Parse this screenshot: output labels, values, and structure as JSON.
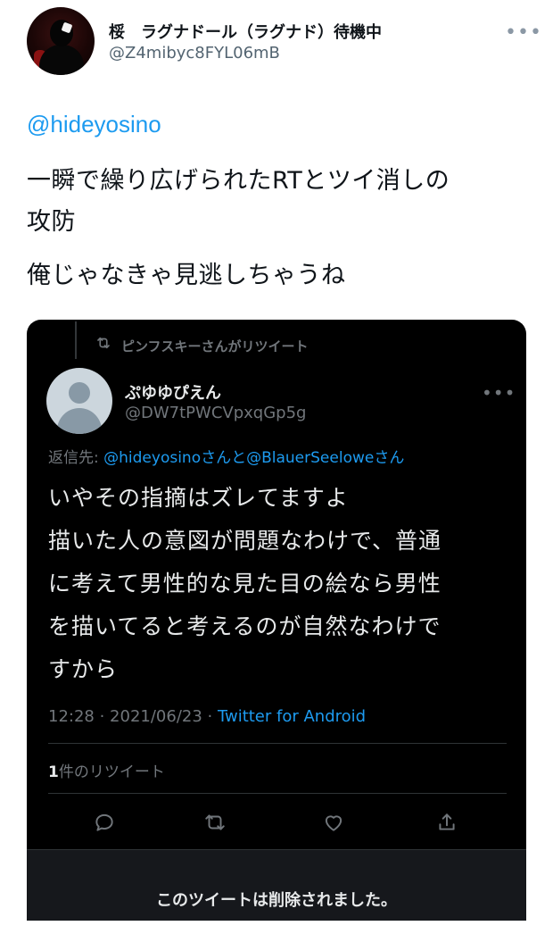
{
  "outer_tweet": {
    "display_name": "桵　ラグナドール（ラグナド）待機中",
    "handle": "@Z4mibyc8FYL06mB",
    "more_icon": "more-horizontal-icon",
    "mention": "@hideyosino",
    "body_lines": [
      "一瞬で繰り広げられたRTとツイ消しの",
      "攻防",
      "俺じゃなきゃ見逃しちゃうね"
    ]
  },
  "quoted_tweet": {
    "retweet_context": "ピンフスキーさんがリツイート",
    "display_name": "ぷゆゆぴえん",
    "handle": "@DW7tPWCVpxqGp5g",
    "reply_to_prefix": "返信先: ",
    "reply_to_user_1": "@hideyosino",
    "reply_to_san_1": "さんと",
    "reply_to_user_2": "@BlauerSeelowe",
    "reply_to_san_2": "さん",
    "body_lines": [
      "いやその指摘はズレてますよ",
      "描いた人の意図が問題なわけで、普通",
      "に考えて男性的な見た目の絵なら男性",
      "を描いてると考えるのが自然なわけで",
      "すから"
    ],
    "timestamp": "12:28 · 2021/06/23 · ",
    "client": "Twitter for Android",
    "retweet_count": "1",
    "retweet_count_label": "件のリツイート",
    "actions": [
      "reply-icon",
      "retweet-icon",
      "like-icon",
      "share-icon"
    ],
    "deleted_notice": "このツイートは削除されました。"
  },
  "colors": {
    "link_blue": "#1d9bf0",
    "dark_bg": "#000000",
    "muted": "#71767b"
  }
}
